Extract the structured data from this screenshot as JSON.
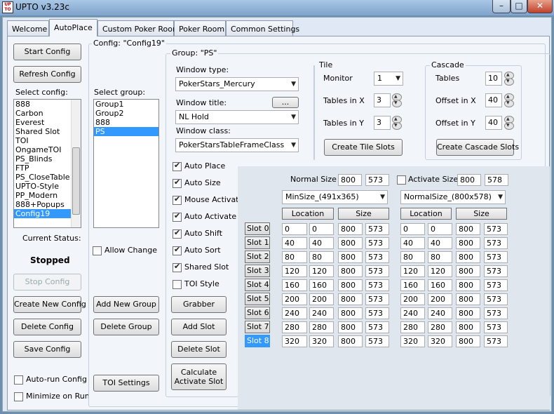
{
  "window": {
    "title": "UPTO  v3.23c",
    "logo_text": "UPTO"
  },
  "tabs": [
    {
      "label": "Welcome"
    },
    {
      "label": "AutoPlace"
    },
    {
      "label": "Custom Poker Room"
    },
    {
      "label": "Poker Room"
    },
    {
      "label": "Common Settings"
    }
  ],
  "left": {
    "start_config": "Start Config",
    "refresh_config": "Refresh Config",
    "select_config_label": "Select config:",
    "configs": [
      "888",
      "Carbon",
      "Everest",
      "Shared Slot",
      "TOI",
      "OngameTOI",
      "PS_Blinds",
      "FTP",
      "PS_CloseTable",
      "UPTO-Style",
      "PP_Modern",
      "888+Popups",
      "Config19"
    ],
    "selected_config": "Config19",
    "current_status_label": "Current Status:",
    "status": "Stopped",
    "stop_config": "Stop Config",
    "create_new_config": "Create New Config",
    "delete_config": "Delete Config",
    "save_config": "Save Config",
    "auto_run": "Auto-run Config",
    "minimize": "Minimize on Run"
  },
  "config": {
    "title": "Config: \"Config19\"",
    "select_group_label": "Select group:",
    "groups": [
      "Group1",
      "Group2",
      "888",
      "PS"
    ],
    "selected_group": "PS",
    "allow_change": "Allow Change",
    "add_group": "Add New Group",
    "delete_group": "Delete Group",
    "toi_settings": "TOI Settings"
  },
  "group": {
    "title": "Group: \"PS\"",
    "window_type_label": "Window type:",
    "window_type": "PokerStars_Mercury",
    "window_title_label": "Window title:",
    "window_title_btn": "...",
    "window_title": "NL Hold",
    "window_class_label": "Window class:",
    "window_class": "PokerStarsTableFrameClass",
    "options": [
      {
        "label": "Auto Place",
        "checked": true
      },
      {
        "label": "Auto Size",
        "checked": true
      },
      {
        "label": "Mouse Activate",
        "checked": true
      },
      {
        "label": "Auto Activate",
        "checked": true
      },
      {
        "label": "Auto Shift",
        "checked": true
      },
      {
        "label": "Auto Sort",
        "checked": true
      },
      {
        "label": "Shared Slot",
        "checked": true
      },
      {
        "label": "TOI Style",
        "checked": false
      }
    ],
    "grabber": "Grabber",
    "add_slot": "Add Slot",
    "delete_slot": "Delete Slot",
    "calculate_1": "Calculate",
    "calculate_2": "Activate Slot"
  },
  "tile": {
    "title": "Tile",
    "monitor_label": "Monitor",
    "monitor": "1",
    "tx_label": "Tables in X",
    "tx": "3",
    "ty_label": "Tables in Y",
    "ty": "3",
    "create": "Create Tile Slots"
  },
  "cascade": {
    "title": "Cascade",
    "tables_label": "Tables",
    "tables": "10",
    "ox_label": "Offset in X",
    "ox": "40",
    "oy_label": "Offset in Y",
    "oy": "40",
    "create": "Create Cascade Slots"
  },
  "slots": {
    "normal_size_label": "Normal Size",
    "normal_w": "800",
    "normal_h": "573",
    "activate_size_label": "Activate Size",
    "activate_w": "800",
    "activate_h": "578",
    "min_combo": "MinSize_(491x365)",
    "normal_combo": "NormalSize_(800x578)",
    "location_hdr": "Location",
    "size_hdr": "Size",
    "selected_slot": "Slot 8",
    "rows": [
      {
        "name": "Slot 0",
        "lx": "0",
        "ly": "0",
        "w": "800",
        "h": "573",
        "alx": "0",
        "aly": "0",
        "aw": "800",
        "ah": "573"
      },
      {
        "name": "Slot 1",
        "lx": "40",
        "ly": "40",
        "w": "800",
        "h": "573",
        "alx": "40",
        "aly": "40",
        "aw": "800",
        "ah": "573"
      },
      {
        "name": "Slot 2",
        "lx": "80",
        "ly": "80",
        "w": "800",
        "h": "573",
        "alx": "80",
        "aly": "80",
        "aw": "800",
        "ah": "573"
      },
      {
        "name": "Slot 3",
        "lx": "120",
        "ly": "120",
        "w": "800",
        "h": "573",
        "alx": "120",
        "aly": "120",
        "aw": "800",
        "ah": "573"
      },
      {
        "name": "Slot 4",
        "lx": "160",
        "ly": "160",
        "w": "800",
        "h": "573",
        "alx": "160",
        "aly": "160",
        "aw": "800",
        "ah": "573"
      },
      {
        "name": "Slot 5",
        "lx": "200",
        "ly": "200",
        "w": "800",
        "h": "573",
        "alx": "200",
        "aly": "200",
        "aw": "800",
        "ah": "573"
      },
      {
        "name": "Slot 6",
        "lx": "240",
        "ly": "240",
        "w": "800",
        "h": "573",
        "alx": "240",
        "aly": "240",
        "aw": "800",
        "ah": "573"
      },
      {
        "name": "Slot 7",
        "lx": "280",
        "ly": "280",
        "w": "800",
        "h": "573",
        "alx": "280",
        "aly": "280",
        "aw": "800",
        "ah": "573"
      },
      {
        "name": "Slot 8",
        "lx": "320",
        "ly": "320",
        "w": "800",
        "h": "573",
        "alx": "320",
        "aly": "320",
        "aw": "800",
        "ah": "573"
      }
    ]
  }
}
